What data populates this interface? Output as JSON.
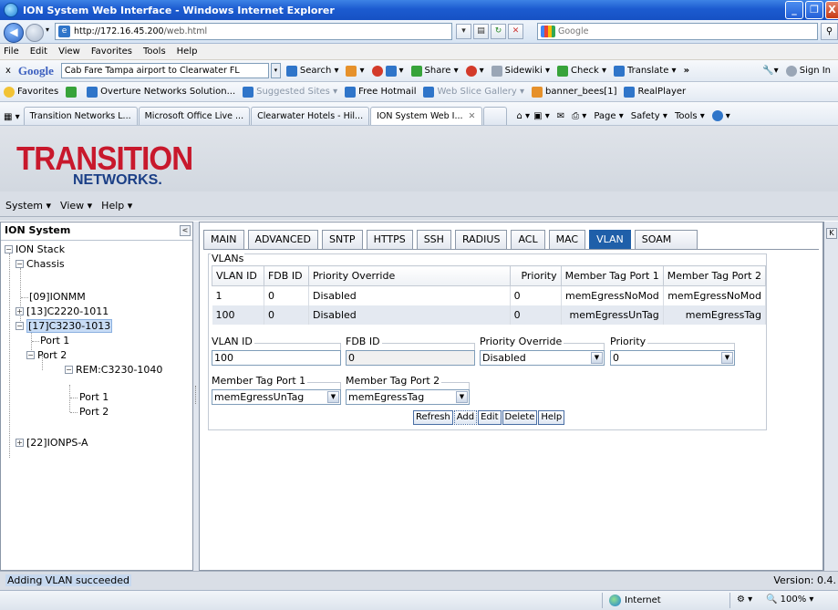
{
  "browser": {
    "title": "ION System Web Interface - Windows Internet Explorer",
    "url_host": "http://172.16.45.200",
    "url_path": "/web.html",
    "search_engine": "Google",
    "menu": [
      "File",
      "Edit",
      "View",
      "Favorites",
      "Tools",
      "Help"
    ],
    "google_toolbar": {
      "close": "x",
      "brand": "Google",
      "query": "Cab Fare Tampa airport to Clearwater FL",
      "search": "Search",
      "share": "Share",
      "sidewiki": "Sidewiki",
      "check": "Check",
      "translate": "Translate",
      "more": "»",
      "sign_in": "Sign In"
    },
    "favorites_bar": {
      "favorites": "Favorites",
      "items": [
        "Overture Networks Solution...",
        "Suggested Sites",
        "Free Hotmail",
        "Web Slice Gallery",
        "banner_bees[1]",
        "RealPlayer"
      ]
    },
    "tabs": [
      "Transition Networks L...",
      "Microsoft Office Live ...",
      "Clearwater Hotels - Hil...",
      "ION System Web I..."
    ],
    "command_bar": [
      "Page",
      "Safety",
      "Tools"
    ],
    "status": {
      "zone": "Internet",
      "zoom": "100%"
    }
  },
  "app": {
    "logo_main": "TRANSITION",
    "logo_sub": "NETWORKS.",
    "menu": [
      "System ▾",
      "View ▾",
      "Help ▾"
    ],
    "tree_title": "ION System",
    "tree": {
      "stack": "ION Stack",
      "chassis": "Chassis",
      "ionmm": "[09]IONMM",
      "c2220": "[13]C2220-1011",
      "c3230": "[17]C3230-1013",
      "port1": "Port 1",
      "port2": "Port 2",
      "rem": "REM:C3230-1040",
      "rem_port1": "Port 1",
      "rem_port2": "Port 2",
      "ionps": "[22]IONPS-A"
    },
    "tabs": [
      "MAIN",
      "ADVANCED",
      "SNTP",
      "HTTPS",
      "SSH",
      "RADIUS",
      "ACL",
      "MAC",
      "VLAN",
      "SOAM"
    ],
    "active_tab": "VLAN",
    "vlans": {
      "legend": "VLANs",
      "columns": [
        "VLAN ID",
        "FDB ID",
        "Priority Override",
        "Priority",
        "Member Tag Port 1",
        "Member Tag Port 2"
      ],
      "rows": [
        [
          "1",
          "0",
          "Disabled",
          "0",
          "memEgressNoMod",
          "memEgressNoMod"
        ],
        [
          "100",
          "0",
          "Disabled",
          "0",
          "memEgressUnTag",
          "memEgressTag"
        ]
      ]
    },
    "form": {
      "vlan_id_label": "VLAN ID",
      "vlan_id_value": "100",
      "fdb_id_label": "FDB ID",
      "fdb_id_value": "0",
      "priority_override_label": "Priority Override",
      "priority_override_value": "Disabled",
      "priority_label": "Priority",
      "priority_value": "0",
      "tag1_label": "Member Tag Port 1",
      "tag1_value": "memEgressUnTag",
      "tag2_label": "Member Tag Port 2",
      "tag2_value": "memEgressTag"
    },
    "buttons": {
      "refresh": "Refresh",
      "add": "Add",
      "edit": "Edit",
      "delete": "Delete",
      "help": "Help"
    },
    "status_message": "Adding VLAN succeeded",
    "version": "Version: 0.4."
  }
}
